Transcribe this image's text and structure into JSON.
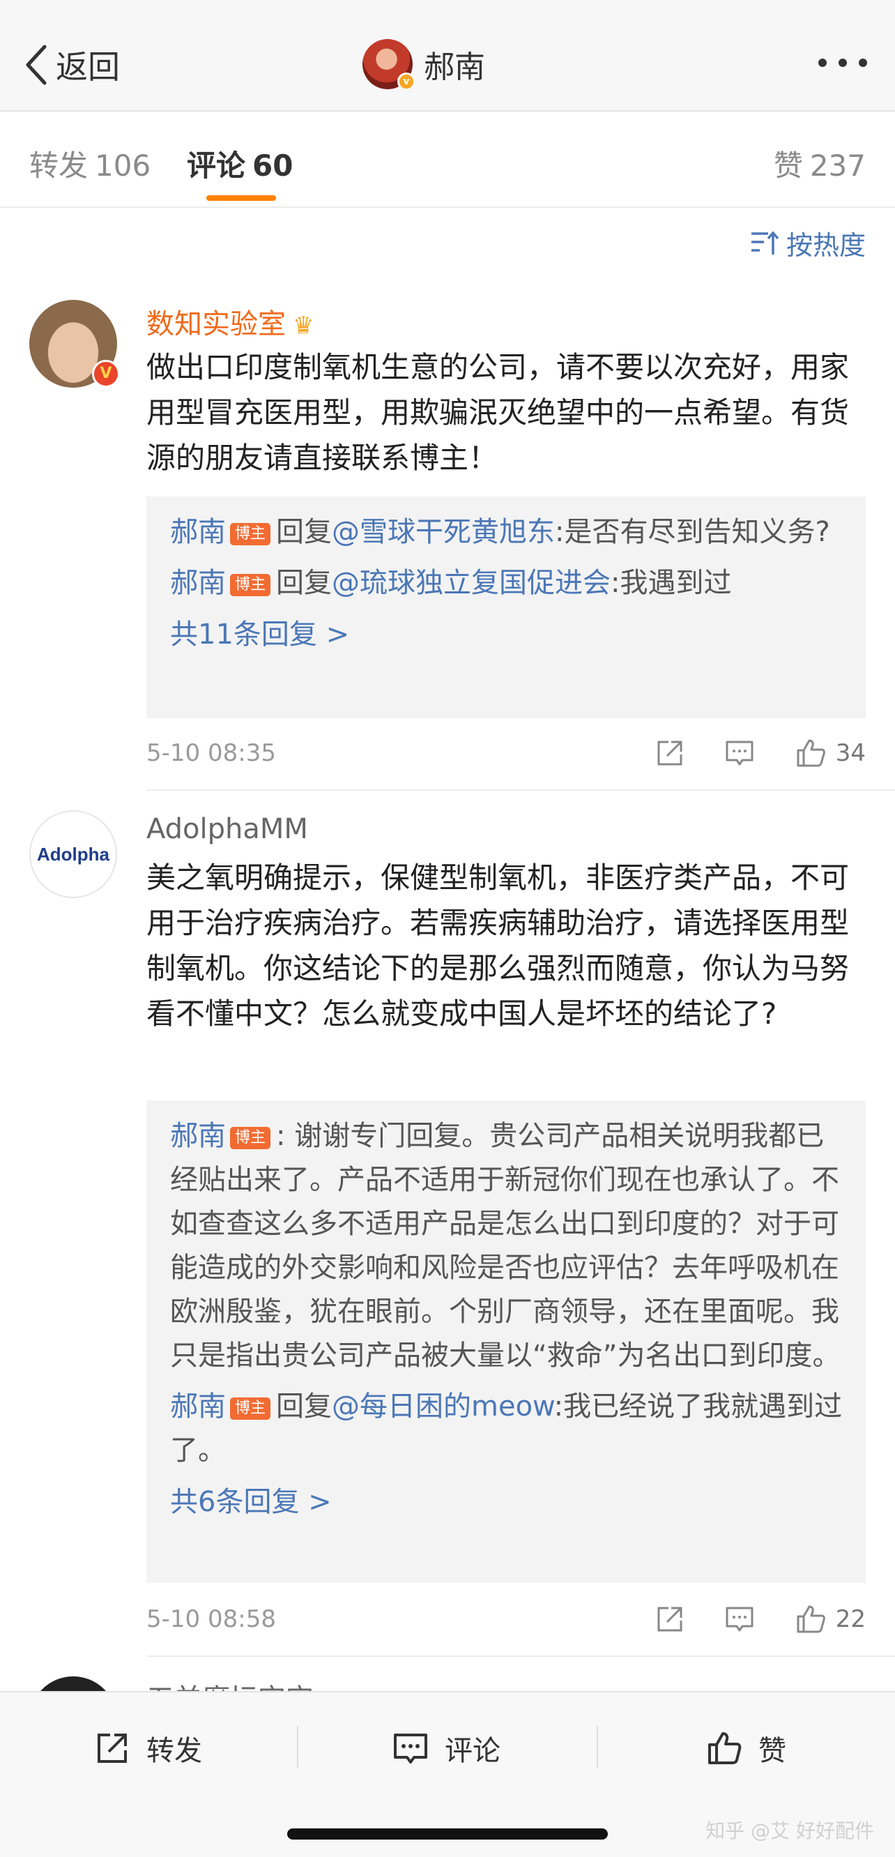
{
  "header": {
    "back_label": "返回",
    "title": "郝南"
  },
  "tabs": {
    "repost": {
      "label": "转发",
      "count": "106"
    },
    "comment": {
      "label": "评论",
      "count": "60"
    },
    "like": {
      "label": "赞",
      "count": "237"
    }
  },
  "sort": {
    "label": "按热度"
  },
  "comments": [
    {
      "user": "数知实验室",
      "text": "做出口印度制氧机生意的公司，请不要以次充好，用家用型冒充医用型，用欺骗泯灭绝望中的一点希望。有货源的朋友请直接联系博主！",
      "replies": [
        {
          "author": "郝南",
          "badge": "博主",
          "action": "回复",
          "mention": "@雪球干死黄旭东",
          "text": ":是否有尽到告知义务?"
        },
        {
          "author": "郝南",
          "badge": "博主",
          "action": "回复",
          "mention": "@琉球独立复国促进会",
          "text": ":我遇到过"
        }
      ],
      "more_replies": "共11条回复 >",
      "time": "5-10 08:35",
      "likes": "34"
    },
    {
      "user": "AdolphaMM",
      "avatar_text": "Adolpha",
      "text": "美之氧明确提示，保健型制氧机，非医疗类产品，不可用于治疗疾病治疗。若需疾病辅助治疗，请选择医用型制氧机。你这结论下的是那么强烈而随意，你认为马努看不懂中文？怎么就变成中国人是坏坯的结论了?",
      "replies": [
        {
          "author": "郝南",
          "badge": "博主",
          "text": ": 谢谢专门回复。贵公司产品相关说明我都已经贴出来了。产品不适用于新冠你们现在也承认了。不如查查这么多不适用产品是怎么出口到印度的？对于可能造成的外交影响和风险是否也应评估？去年呼吸机在欧洲殷鉴，犹在眼前。个别厂商领导，还在里面呢。我只是指出贵公司产品被大量以“救命”为名出口到印度。"
        },
        {
          "author": "郝南",
          "badge": "博主",
          "action": "回复",
          "mention": "@每日困的meow",
          "text": ":我已经说了我就遇到过了。"
        }
      ],
      "more_replies": "共6条回复 >",
      "time": "5-10 08:58",
      "likes": "22"
    },
    {
      "user": "五羊魔坛宝宝"
    }
  ],
  "bottom_bar": {
    "repost": "转发",
    "comment": "评论",
    "like": "赞"
  },
  "watermark": "知乎 @艾 好好配件"
}
